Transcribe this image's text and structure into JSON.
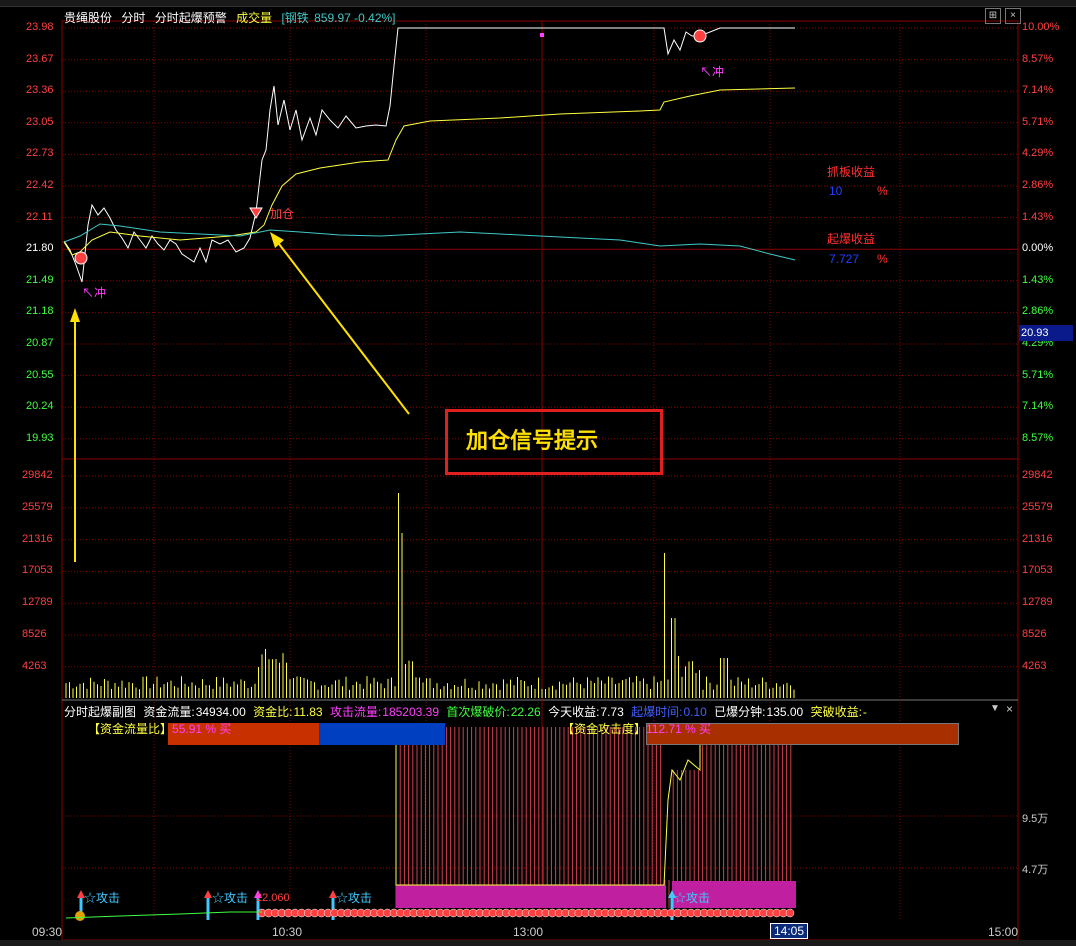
{
  "header": {
    "stock_name": "贵绳股份",
    "mode": "分时",
    "indicator": "分时起爆预警",
    "volume_label": "成交量",
    "sector": "[钢铁",
    "sector_value": "859.97 -0.42%]"
  },
  "price_axis": {
    "left_labels": [
      "23.98",
      "23.67",
      "23.36",
      "23.05",
      "22.73",
      "22.42",
      "22.11",
      "21.80",
      "21.49",
      "21.18",
      "20.87",
      "20.55",
      "20.24",
      "19.93"
    ],
    "right_labels": [
      "10.00%",
      "8.57%",
      "7.14%",
      "5.71%",
      "4.29%",
      "2.86%",
      "1.43%",
      "0.00%",
      "1.43%",
      "2.86%",
      "4.29%",
      "5.71%",
      "7.14%",
      "8.57%"
    ],
    "current_price": "20.93"
  },
  "volume_axis": {
    "labels": [
      "29842",
      "25579",
      "21316",
      "17053",
      "12789",
      "8526",
      "4263"
    ]
  },
  "annotations": {
    "chong1": "↖冲",
    "chong2": "↖冲",
    "jiacang": "加仓",
    "zhuaban_label": "抓板收益",
    "zhuaban_value": "10",
    "zhuaban_unit": "%",
    "qibao_label": "起爆收益",
    "qibao_value": "7.727",
    "qibao_unit": "%",
    "callout": "加仓信号提示"
  },
  "sub_chart": {
    "title": "分时起爆副图",
    "fund_flow_label": "资金流量:",
    "fund_flow_value": "34934.00",
    "fund_ratio_label": "资金比:",
    "fund_ratio_value": "11.83",
    "attack_flow_label": "攻击流量:",
    "attack_flow_value": "185203.39",
    "first_break_label": "首次爆破价:",
    "first_break_value": "22.26",
    "today_profit_label": "今天收益:",
    "today_profit_value": "7.73",
    "burst_time_label": "起爆时间:",
    "burst_time_value": "0.10",
    "burst_min_label": "已爆分钟:",
    "burst_min_value": "135.00",
    "break_profit_label": "突破收益:",
    "break_profit_value": "-",
    "fund_ratio_bar_label": "【资金流量比】",
    "fund_ratio_bar_value": "55.91 % 买",
    "attack_degree_label": "【资金攻击度】",
    "attack_degree_value": "112.71 % 买",
    "axis_labels": [
      "9.5万",
      "4.7万"
    ],
    "attack_tags": [
      "☆攻击",
      "☆攻击",
      "☆攻击",
      "☆攻击"
    ],
    "num_tag": "22.060"
  },
  "time_axis": {
    "labels": [
      "09:30",
      "10:30",
      "13:00",
      "15:00"
    ],
    "current": "14:05"
  },
  "colors": {
    "grid_red": "#8a0000",
    "price_line": "#ffffff",
    "avg_line": "#ffff40",
    "cyan_line": "#40c8c8",
    "up_red": "#ff4040",
    "down_green": "#40ff40",
    "yellow": "#ffe000",
    "magenta": "#ff40ff"
  },
  "chart_data": {
    "type": "line",
    "title": "",
    "series": [
      {
        "name": "",
        "x": [
          "09:30",
          "09:35",
          "09:40",
          "09:45",
          "09:50",
          "09:55",
          "10:00",
          "10:10",
          "10:20",
          "10:30",
          "10:35",
          "10:40",
          "10:45",
          "10:50",
          "11:00",
          "11:10",
          "11:20",
          "11:30",
          "13:00",
          "13:30",
          "14:00",
          "14:05"
        ],
        "values": [
          21.8,
          21.55,
          22.2,
          22.05,
          21.95,
          21.82,
          21.75,
          21.8,
          21.82,
          22.2,
          22.5,
          23.4,
          23.2,
          23.1,
          23.05,
          23.05,
          23.98,
          23.98,
          23.98,
          23.98,
          23.8,
          23.98
        ]
      }
    ],
    "ylim": [
      19.93,
      23.98
    ],
    "xlabel": "",
    "ylabel": ""
  }
}
